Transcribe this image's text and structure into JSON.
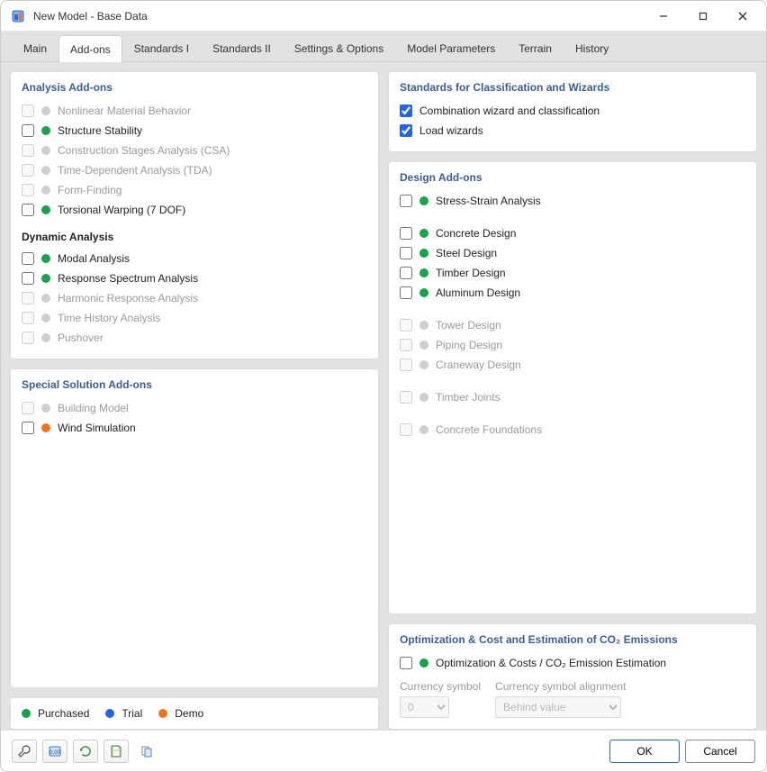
{
  "window": {
    "title": "New Model - Base Data"
  },
  "tabs": [
    {
      "label": "Main",
      "active": false
    },
    {
      "label": "Add-ons",
      "active": true
    },
    {
      "label": "Standards I",
      "active": false
    },
    {
      "label": "Standards II",
      "active": false
    },
    {
      "label": "Settings & Options",
      "active": false
    },
    {
      "label": "Model Parameters",
      "active": false
    },
    {
      "label": "Terrain",
      "active": false
    },
    {
      "label": "History",
      "active": false
    }
  ],
  "analysis": {
    "title": "Analysis Add-ons",
    "items": [
      {
        "label": "Nonlinear Material Behavior",
        "checked": false,
        "enabled": false,
        "dot": "grey"
      },
      {
        "label": "Structure Stability",
        "checked": false,
        "enabled": true,
        "dot": "green"
      },
      {
        "label": "Construction Stages Analysis (CSA)",
        "checked": false,
        "enabled": false,
        "dot": "grey"
      },
      {
        "label": "Time-Dependent Analysis (TDA)",
        "checked": false,
        "enabled": false,
        "dot": "grey"
      },
      {
        "label": "Form-Finding",
        "checked": false,
        "enabled": false,
        "dot": "grey"
      },
      {
        "label": "Torsional Warping (7 DOF)",
        "checked": false,
        "enabled": true,
        "dot": "green"
      }
    ],
    "dynamic_title": "Dynamic Analysis",
    "dynamic_items": [
      {
        "label": "Modal Analysis",
        "checked": false,
        "enabled": true,
        "dot": "green"
      },
      {
        "label": "Response Spectrum Analysis",
        "checked": false,
        "enabled": true,
        "dot": "green"
      },
      {
        "label": "Harmonic Response Analysis",
        "checked": false,
        "enabled": false,
        "dot": "grey"
      },
      {
        "label": "Time History Analysis",
        "checked": false,
        "enabled": false,
        "dot": "grey"
      },
      {
        "label": "Pushover",
        "checked": false,
        "enabled": false,
        "dot": "grey"
      }
    ]
  },
  "special": {
    "title": "Special Solution Add-ons",
    "items": [
      {
        "label": "Building Model",
        "checked": false,
        "enabled": false,
        "dot": "grey"
      },
      {
        "label": "Wind Simulation",
        "checked": false,
        "enabled": true,
        "dot": "orange"
      }
    ]
  },
  "legend": {
    "purchased": "Purchased",
    "trial": "Trial",
    "demo": "Demo"
  },
  "standards": {
    "title": "Standards for Classification and Wizards",
    "items": [
      {
        "label": "Combination wizard and classification",
        "checked": true,
        "enabled": true
      },
      {
        "label": "Load wizards",
        "checked": true,
        "enabled": true
      }
    ]
  },
  "design": {
    "title": "Design Add-ons",
    "items": [
      {
        "label": "Stress-Strain Analysis",
        "checked": false,
        "enabled": true,
        "dot": "green",
        "gap": false
      },
      {
        "label": "Concrete Design",
        "checked": false,
        "enabled": true,
        "dot": "green",
        "gap": true
      },
      {
        "label": "Steel Design",
        "checked": false,
        "enabled": true,
        "dot": "green",
        "gap": false
      },
      {
        "label": "Timber Design",
        "checked": false,
        "enabled": true,
        "dot": "green",
        "gap": false
      },
      {
        "label": "Aluminum Design",
        "checked": false,
        "enabled": true,
        "dot": "green",
        "gap": false
      },
      {
        "label": "Tower Design",
        "checked": false,
        "enabled": false,
        "dot": "grey",
        "gap": true
      },
      {
        "label": "Piping Design",
        "checked": false,
        "enabled": false,
        "dot": "grey",
        "gap": false
      },
      {
        "label": "Craneway Design",
        "checked": false,
        "enabled": false,
        "dot": "grey",
        "gap": false
      },
      {
        "label": "Timber Joints",
        "checked": false,
        "enabled": false,
        "dot": "grey",
        "gap": true
      },
      {
        "label": "Concrete Foundations",
        "checked": false,
        "enabled": false,
        "dot": "grey",
        "gap": true
      }
    ]
  },
  "optimization": {
    "title_html": "Optimization & Cost and Estimation of CO₂ Emissions",
    "item_label": "Optimization & Costs / CO₂ Emission Estimation",
    "item_checked": false,
    "item_dot": "green",
    "currency_label": "Currency symbol",
    "currency_value": "0",
    "alignment_label": "Currency symbol alignment",
    "alignment_value": "Behind value"
  },
  "buttons": {
    "ok": "OK",
    "cancel": "Cancel"
  }
}
